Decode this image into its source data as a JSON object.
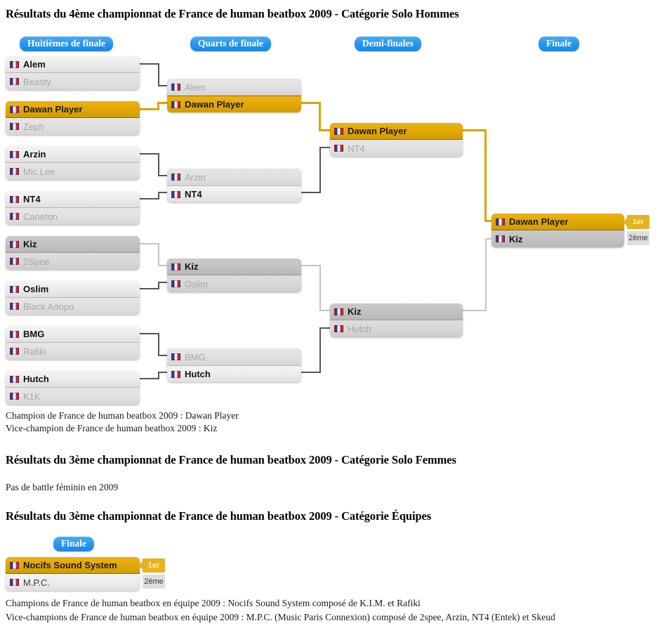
{
  "sections": {
    "solo_hommes": {
      "title": "Résultats du 4ème championnat de France de human beatbox 2009 - Catégorie Solo Hommes",
      "rounds": [
        {
          "label": "Huitièmes de finale"
        },
        {
          "label": "Quarts de finale"
        },
        {
          "label": "Demi-finales"
        },
        {
          "label": "Finale"
        }
      ],
      "r16": [
        {
          "top": "Alem",
          "bottom": "Beasty",
          "top_state": "win",
          "bottom_state": "lose"
        },
        {
          "top": "Dawan Player",
          "bottom": "Zeph",
          "top_state": "gold",
          "bottom_state": "lose"
        },
        {
          "top": "Arzin",
          "bottom": "Mic Lee",
          "top_state": "win",
          "bottom_state": "lose"
        },
        {
          "top": "NT4",
          "bottom": "Caneton",
          "top_state": "win",
          "bottom_state": "lose"
        },
        {
          "top": "Kiz",
          "bottom": "2Spee",
          "top_state": "silver",
          "bottom_state": "lose-dark"
        },
        {
          "top": "Oslim",
          "bottom": "Black Adopo",
          "top_state": "win",
          "bottom_state": "lose"
        },
        {
          "top": "BMG",
          "bottom": "Rafiki",
          "top_state": "win",
          "bottom_state": "lose"
        },
        {
          "top": "Hutch",
          "bottom": "K1K",
          "top_state": "win",
          "bottom_state": "lose"
        }
      ],
      "quarters": [
        {
          "top": "Alem",
          "bottom": "Dawan Player",
          "top_state": "lose",
          "bottom_state": "gold"
        },
        {
          "top": "Arzin",
          "bottom": "NT4",
          "top_state": "lose",
          "bottom_state": "win"
        },
        {
          "top": "Kiz",
          "bottom": "Oslim",
          "top_state": "silver",
          "bottom_state": "lose-dark"
        },
        {
          "top": "BMG",
          "bottom": "Hutch",
          "top_state": "lose",
          "bottom_state": "win"
        }
      ],
      "semis": [
        {
          "top": "Dawan Player",
          "bottom": "NT4",
          "top_state": "gold",
          "bottom_state": "lose"
        },
        {
          "top": "Kiz",
          "bottom": "Hutch",
          "top_state": "silver",
          "bottom_state": "lose-dark"
        }
      ],
      "final": {
        "top": "Dawan Player",
        "bottom": "Kiz",
        "top_state": "gold",
        "bottom_state": "silver",
        "rank_first": "1er",
        "rank_second": "2ème"
      },
      "captions": [
        "Champion de France de human beatbox 2009 : Dawan Player",
        "Vice-champion de France de human beatbox 2009 : Kiz"
      ]
    },
    "solo_femmes": {
      "title": "Résultats du 3ème championnat de France de human beatbox 2009 - Catégorie Solo Femmes",
      "note": "Pas de battle féminin en 2009"
    },
    "equipes": {
      "title": "Résultats du 3ème championnat de France de human beatbox 2009 - Catégorie Équipes",
      "round_label": "Finale",
      "final": {
        "top": "Nocifs Sound System",
        "bottom": "M.P.C.",
        "top_state": "gold",
        "bottom_state": "lose-light",
        "rank_first": "1er",
        "rank_second": "2ème"
      },
      "captions": [
        "Champions de France de human beatbox en équipe 2009 : Nocifs Sound System composé de K.I.M. et Rafiki",
        "Vice-champions de France de human beatbox en équipe 2009 : M.P.C. (Music Paris Connexion) composé de 2spee, Arzin, NT4 (Entek) et Skeud"
      ]
    }
  },
  "colors": {
    "gold": "#e0a705",
    "badge_blue": "#2a9ef4",
    "line": "#555555",
    "line_gold": "#d8a400",
    "line_silver": "#c3c3c3"
  }
}
